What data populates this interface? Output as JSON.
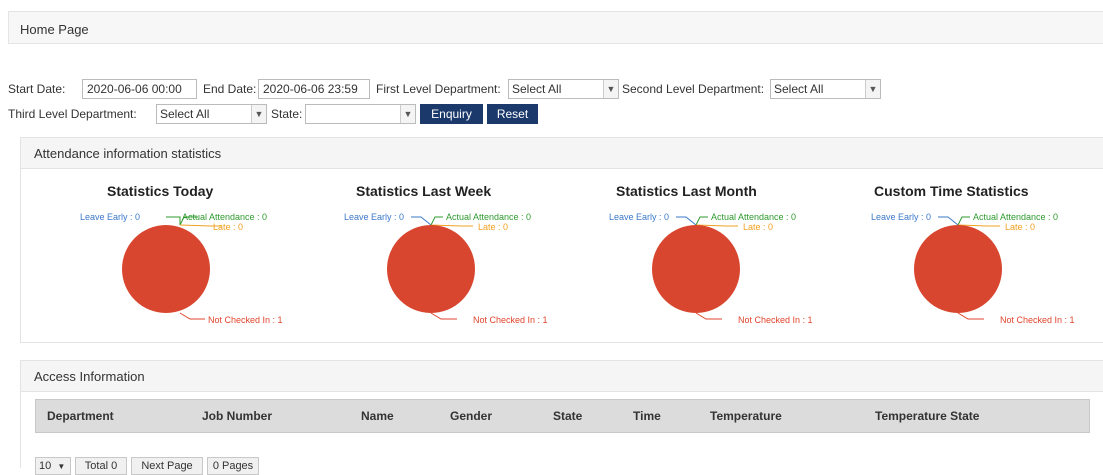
{
  "header": {
    "title": "Home Page"
  },
  "filters": {
    "start_date_label": "Start Date:",
    "start_date_value": "2020-06-06 00:00",
    "end_date_label": "End Date:",
    "end_date_value": "2020-06-06 23:59",
    "first_dept_label": "First Level Department:",
    "first_dept_value": "Select All",
    "second_dept_label": "Second Level Department:",
    "second_dept_value": "Select All",
    "third_dept_label": "Third Level Department:",
    "third_dept_value": "Select All",
    "state_label": "State:",
    "state_value": "",
    "enquiry_label": "Enquiry",
    "reset_label": "Reset"
  },
  "attendance": {
    "title": "Attendance information statistics",
    "charts": [
      {
        "title": "Statistics Today",
        "leave_early": "Leave Early : 0",
        "actual": "Actual Attendance : 0",
        "late": "Late : 0",
        "not_checked": "Not Checked In : 1"
      },
      {
        "title": "Statistics Last Week",
        "leave_early": "Leave Early : 0",
        "actual": "Actual Attendance : 0",
        "late": "Late : 0",
        "not_checked": "Not Checked In : 1"
      },
      {
        "title": "Statistics Last Month",
        "leave_early": "Leave Early : 0",
        "actual": "Actual Attendance : 0",
        "late": "Late : 0",
        "not_checked": "Not Checked In : 1"
      },
      {
        "title": "Custom Time Statistics",
        "leave_early": "Leave Early : 0",
        "actual": "Actual Attendance : 0",
        "late": "Late : 0",
        "not_checked": "Not Checked In : 1"
      }
    ],
    "colors": {
      "pie": "#d9462f",
      "leave_early": "#3b79c9",
      "actual": "#2e9a2e",
      "late": "#f0a020",
      "not_checked": "#e0452c"
    }
  },
  "access": {
    "title": "Access Information",
    "columns": [
      "Department",
      "Job Number",
      "Name",
      "Gender",
      "State",
      "Time",
      "Temperature",
      "Temperature State"
    ]
  },
  "pager": {
    "page_size": "10",
    "total": "Total 0",
    "next": "Next Page",
    "pages": "0 Pages"
  }
}
